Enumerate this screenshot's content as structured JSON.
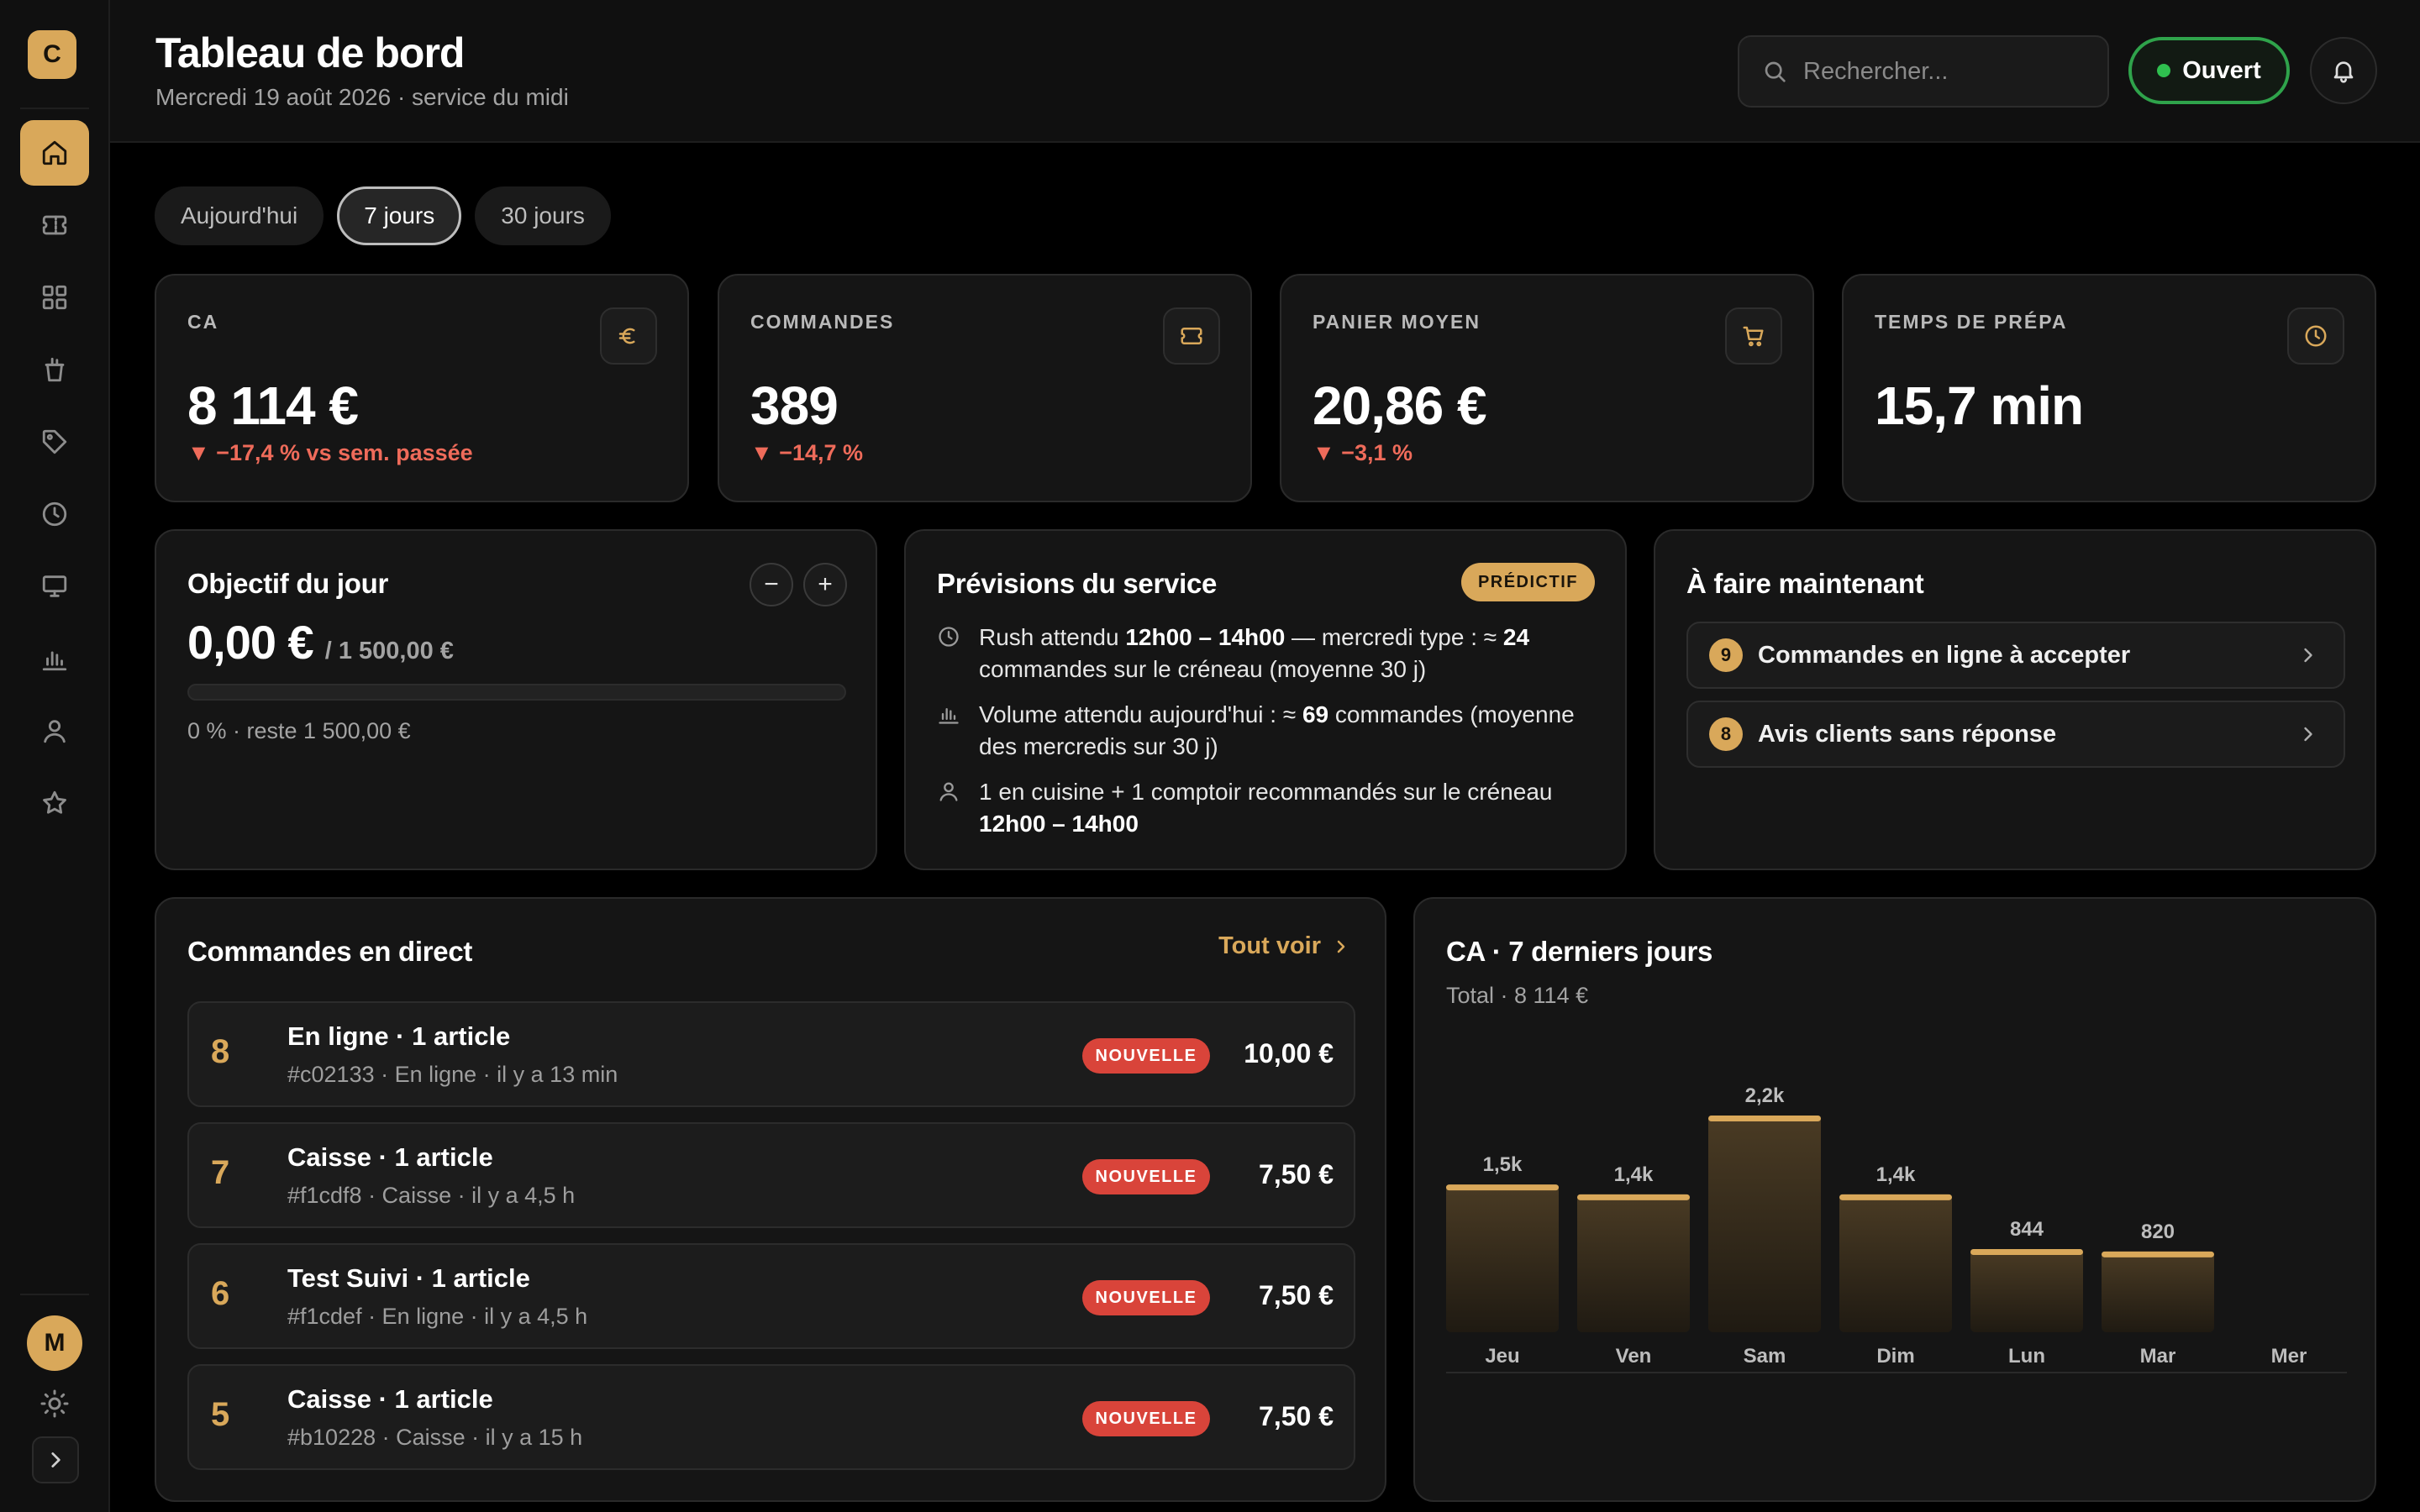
{
  "brand": {
    "initial": "C"
  },
  "header": {
    "title": "Tableau de bord",
    "subtitle": "Mercredi 19 août 2026 · service du midi",
    "search_placeholder": "Rechercher...",
    "status_label": "Ouvert"
  },
  "sidebar": {
    "items": [
      {
        "icon": "home-icon",
        "active": true
      },
      {
        "icon": "ticket-icon",
        "active": false
      },
      {
        "icon": "grid-icon",
        "active": false
      },
      {
        "icon": "cup-icon",
        "active": false
      },
      {
        "icon": "tag-icon",
        "active": false
      },
      {
        "icon": "clock-icon",
        "active": false
      },
      {
        "icon": "monitor-icon",
        "active": false
      },
      {
        "icon": "bar-chart-icon",
        "active": false
      },
      {
        "icon": "user-icon",
        "active": false
      },
      {
        "icon": "star-icon",
        "active": false
      }
    ],
    "avatar_initial": "M"
  },
  "tabs": [
    {
      "label": "Aujourd'hui",
      "active": false
    },
    {
      "label": "7 jours",
      "active": true
    },
    {
      "label": "30 jours",
      "active": false
    }
  ],
  "kpis": [
    {
      "label": "CA",
      "value": "8 114 €",
      "delta": "▼ −17,4 % vs sem. passée",
      "icon": "euro-icon"
    },
    {
      "label": "COMMANDES",
      "value": "389",
      "delta": "▼ −14,7 %",
      "icon": "ticket-icon"
    },
    {
      "label": "PANIER MOYEN",
      "value": "20,86 €",
      "delta": "▼ −3,1 %",
      "icon": "cart-icon"
    },
    {
      "label": "TEMPS DE PRÉPA",
      "value": "15,7 min",
      "delta": "",
      "icon": "clock-icon"
    }
  ],
  "objective": {
    "title": "Objectif du jour",
    "amount": "0,00 €",
    "target": "/ 1 500,00 €",
    "progress_percent": 0,
    "caption": "0 % · reste 1 500,00 €",
    "minus": "−",
    "plus": "+"
  },
  "forecast": {
    "title": "Prévisions du service",
    "badge": "PRÉDICTIF",
    "rows": [
      {
        "icon": "clock-icon",
        "parts": [
          "Rush attendu ",
          "12h00 – 14h00",
          " — mercredi type : ≈ ",
          "24",
          " commandes sur le créneau (moyenne 30 j)"
        ]
      },
      {
        "icon": "bar-chart-icon",
        "parts": [
          "Volume attendu aujourd'hui : ≈ ",
          "69",
          " commandes (moyenne des mercredis sur 30 j)"
        ]
      },
      {
        "icon": "user-icon",
        "parts": [
          "1 en cuisine + 1 comptoir recommandés sur le créneau ",
          "12h00 – 14h00"
        ]
      }
    ]
  },
  "todo": {
    "title": "À faire maintenant",
    "items": [
      {
        "count": "9",
        "label": "Commandes en ligne à accepter"
      },
      {
        "count": "8",
        "label": "Avis clients sans réponse"
      }
    ]
  },
  "orders": {
    "title": "Commandes en direct",
    "see_all": "Tout voir",
    "rows": [
      {
        "num": "8",
        "title": "En ligne · 1 article",
        "meta": "#c02133 · En ligne · il y a 13 min",
        "badge": "NOUVELLE",
        "amount": "10,00 €"
      },
      {
        "num": "7",
        "title": "Caisse · 1 article",
        "meta": "#f1cdf8 · Caisse · il y a 4,5 h",
        "badge": "NOUVELLE",
        "amount": "7,50 €"
      },
      {
        "num": "6",
        "title": "Test Suivi · 1 article",
        "meta": "#f1cdef · En ligne · il y a 4,5 h",
        "badge": "NOUVELLE",
        "amount": "7,50 €"
      },
      {
        "num": "5",
        "title": "Caisse · 1 article",
        "meta": "#b10228 · Caisse · il y a 15 h",
        "badge": "NOUVELLE",
        "amount": "7,50 €"
      }
    ]
  },
  "chart_data": {
    "type": "bar",
    "title": "CA · 7 derniers jours",
    "subtitle": "Total · 8 114 €",
    "categories": [
      "Jeu",
      "Ven",
      "Sam",
      "Dim",
      "Lun",
      "Mar",
      "Mer"
    ],
    "values": [
      1500,
      1400,
      2200,
      1400,
      844,
      820,
      0
    ],
    "data_labels": [
      "1,5k",
      "1,4k",
      "2,2k",
      "1,4k",
      "844",
      "820",
      ""
    ],
    "ylim": [
      0,
      2200
    ],
    "grid": false,
    "legend": "none",
    "colors": {
      "bar_top": "#d9a85a",
      "bar_fill": "#3a2f1f"
    }
  }
}
